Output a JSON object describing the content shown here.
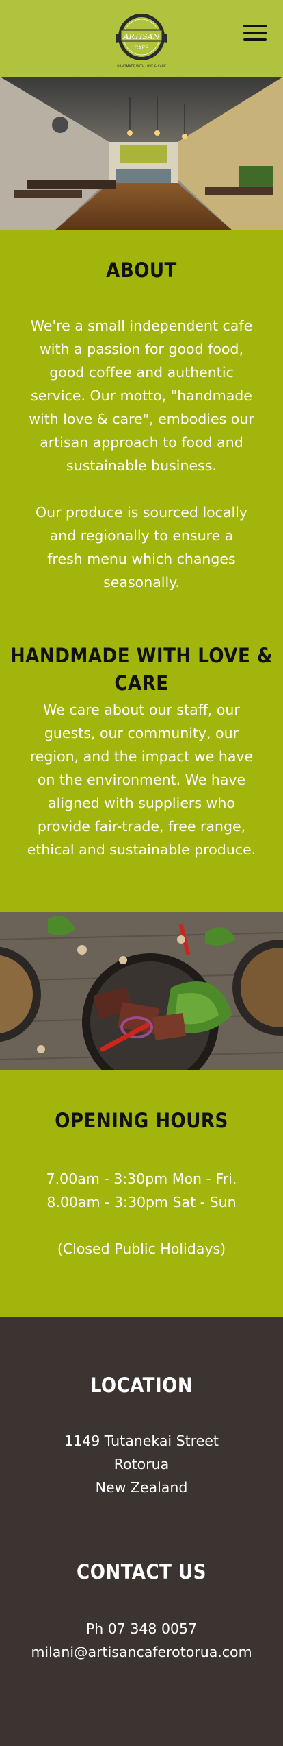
{
  "header": {
    "logo_text": "ARTISAN",
    "logo_sub": "CAFE",
    "logo_tagline": "HANDMADE WITH LOVE & CARE",
    "menu_icon": "hamburger-icon"
  },
  "about": {
    "heading": "ABOUT",
    "p1": "We're a small independent cafe with a passion for good food, good coffee and authentic service. Our motto, \"handmade with love & care\", embodies our artisan approach to food and sustainable business.",
    "p2": "Our produce is sourced locally and regionally to ensure a fresh menu which changes seasonally.",
    "heading2": "HANDMADE WITH LOVE & CARE",
    "p3": "We care about our staff, our guests, our community, our region, and the impact we have on the environment. We have aligned with suppliers who provide fair-trade, free range, ethical and sustainable produce."
  },
  "hours": {
    "heading": "OPENING HOURS",
    "weekday": "7.00am - 3:30pm Mon - Fri.",
    "weekend": "8.00am - 3:30pm Sat - Sun",
    "closed": "(Closed Public Holidays)"
  },
  "location": {
    "heading": "LOCATION",
    "street": "1149 Tutanekai Street",
    "city": "Rotorua",
    "country": "New Zealand"
  },
  "contact": {
    "heading": "CONTACT US",
    "phone": "Ph 07 348 0057",
    "email": "milani@artisancaferotorua.com"
  },
  "colors": {
    "header_bg": "#b0c23e",
    "green": "#a2b50d",
    "dark": "#3b3431"
  }
}
